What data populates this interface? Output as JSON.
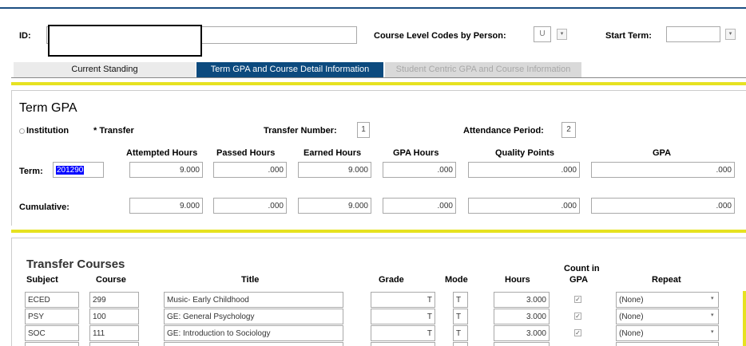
{
  "colors": {
    "accent_blue": "#0c4a7e",
    "accent_yellow": "#e6e221",
    "highlight": "#0000ff"
  },
  "key_block": {
    "id_label": "ID:",
    "id_value": "",
    "course_level_label": "Course Level Codes by Person:",
    "course_level_value": "U",
    "start_term_label": "Start Term:",
    "start_term_value": ""
  },
  "tabs": [
    {
      "label": "Current Standing",
      "state": "inactive"
    },
    {
      "label": "Term GPA and Course Detail Information",
      "state": "active"
    },
    {
      "label": "Student Centric GPA and Course Information",
      "state": "disabled"
    }
  ],
  "term_gpa": {
    "title": "Term GPA",
    "institution_label": "Institution",
    "transfer_label": "Transfer",
    "transfer_selected": true,
    "transfer_number_label": "Transfer Number:",
    "transfer_number_value": "1",
    "attendance_period_label": "Attendance Period:",
    "attendance_period_value": "2",
    "columns": [
      "Attempted Hours",
      "Passed Hours",
      "Earned Hours",
      "GPA Hours",
      "Quality Points",
      "GPA"
    ],
    "term_label": "Term:",
    "term_value": "201290",
    "term_row": [
      "9.000",
      ".000",
      "9.000",
      ".000",
      ".000",
      ".000"
    ],
    "cumulative_label": "Cumulative:",
    "cumulative_row": [
      "9.000",
      ".000",
      "9.000",
      ".000",
      ".000",
      ".000"
    ]
  },
  "transfer_courses": {
    "title": "Transfer Courses",
    "columns": {
      "subject": "Subject",
      "course": "Course",
      "title": "Title",
      "grade": "Grade",
      "mode": "Mode",
      "hours": "Hours",
      "count_in_gpa_1": "Count in",
      "count_in_gpa_2": "GPA",
      "repeat": "Repeat"
    },
    "rows": [
      {
        "subject": "ECED",
        "course": "299",
        "title": "Music- Early Childhood",
        "grade": "T",
        "mode": "T",
        "hours": "3.000",
        "count_in_gpa": true,
        "repeat": "(None)"
      },
      {
        "subject": "PSY",
        "course": "100",
        "title": "GE: General Psychology",
        "grade": "T",
        "mode": "T",
        "hours": "3.000",
        "count_in_gpa": true,
        "repeat": "(None)"
      },
      {
        "subject": "SOC",
        "course": "111",
        "title": "GE: Introduction to Sociology",
        "grade": "T",
        "mode": "T",
        "hours": "3.000",
        "count_in_gpa": true,
        "repeat": "(None)"
      }
    ]
  }
}
